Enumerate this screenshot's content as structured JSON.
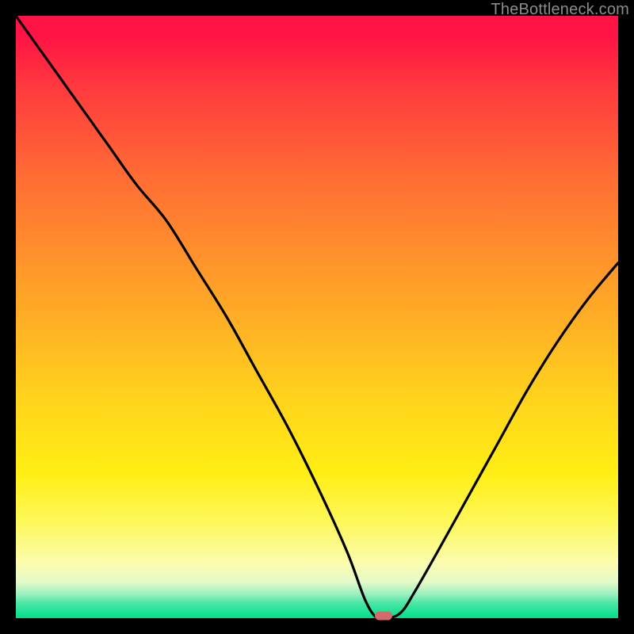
{
  "watermark": "TheBottleneck.com",
  "colors": {
    "frame": "#000000",
    "curve": "#000000",
    "marker": "#d46a6a",
    "gradient_top": "#ff1244",
    "gradient_bottom": "#00df8a"
  },
  "chart_data": {
    "type": "line",
    "title": "",
    "xlabel": "",
    "ylabel": "",
    "xlim": [
      0,
      100
    ],
    "ylim": [
      0,
      100
    ],
    "grid": false,
    "legend": false,
    "series": [
      {
        "name": "bottleneck-curve",
        "x": [
          0,
          5,
          10,
          15,
          20,
          25,
          30,
          35,
          40,
          45,
          50,
          55,
          58,
          60,
          62,
          64,
          66,
          70,
          75,
          80,
          85,
          90,
          95,
          100
        ],
        "y": [
          100,
          93,
          86,
          79,
          72,
          66,
          58,
          50,
          41,
          32,
          22,
          11,
          3,
          0,
          0,
          1,
          4,
          11,
          20,
          29,
          38,
          46,
          53,
          59
        ]
      }
    ],
    "annotations": [
      {
        "name": "optimal-point-marker",
        "x": 61,
        "y": 0,
        "shape": "pill",
        "color": "#d46a6a"
      }
    ]
  }
}
